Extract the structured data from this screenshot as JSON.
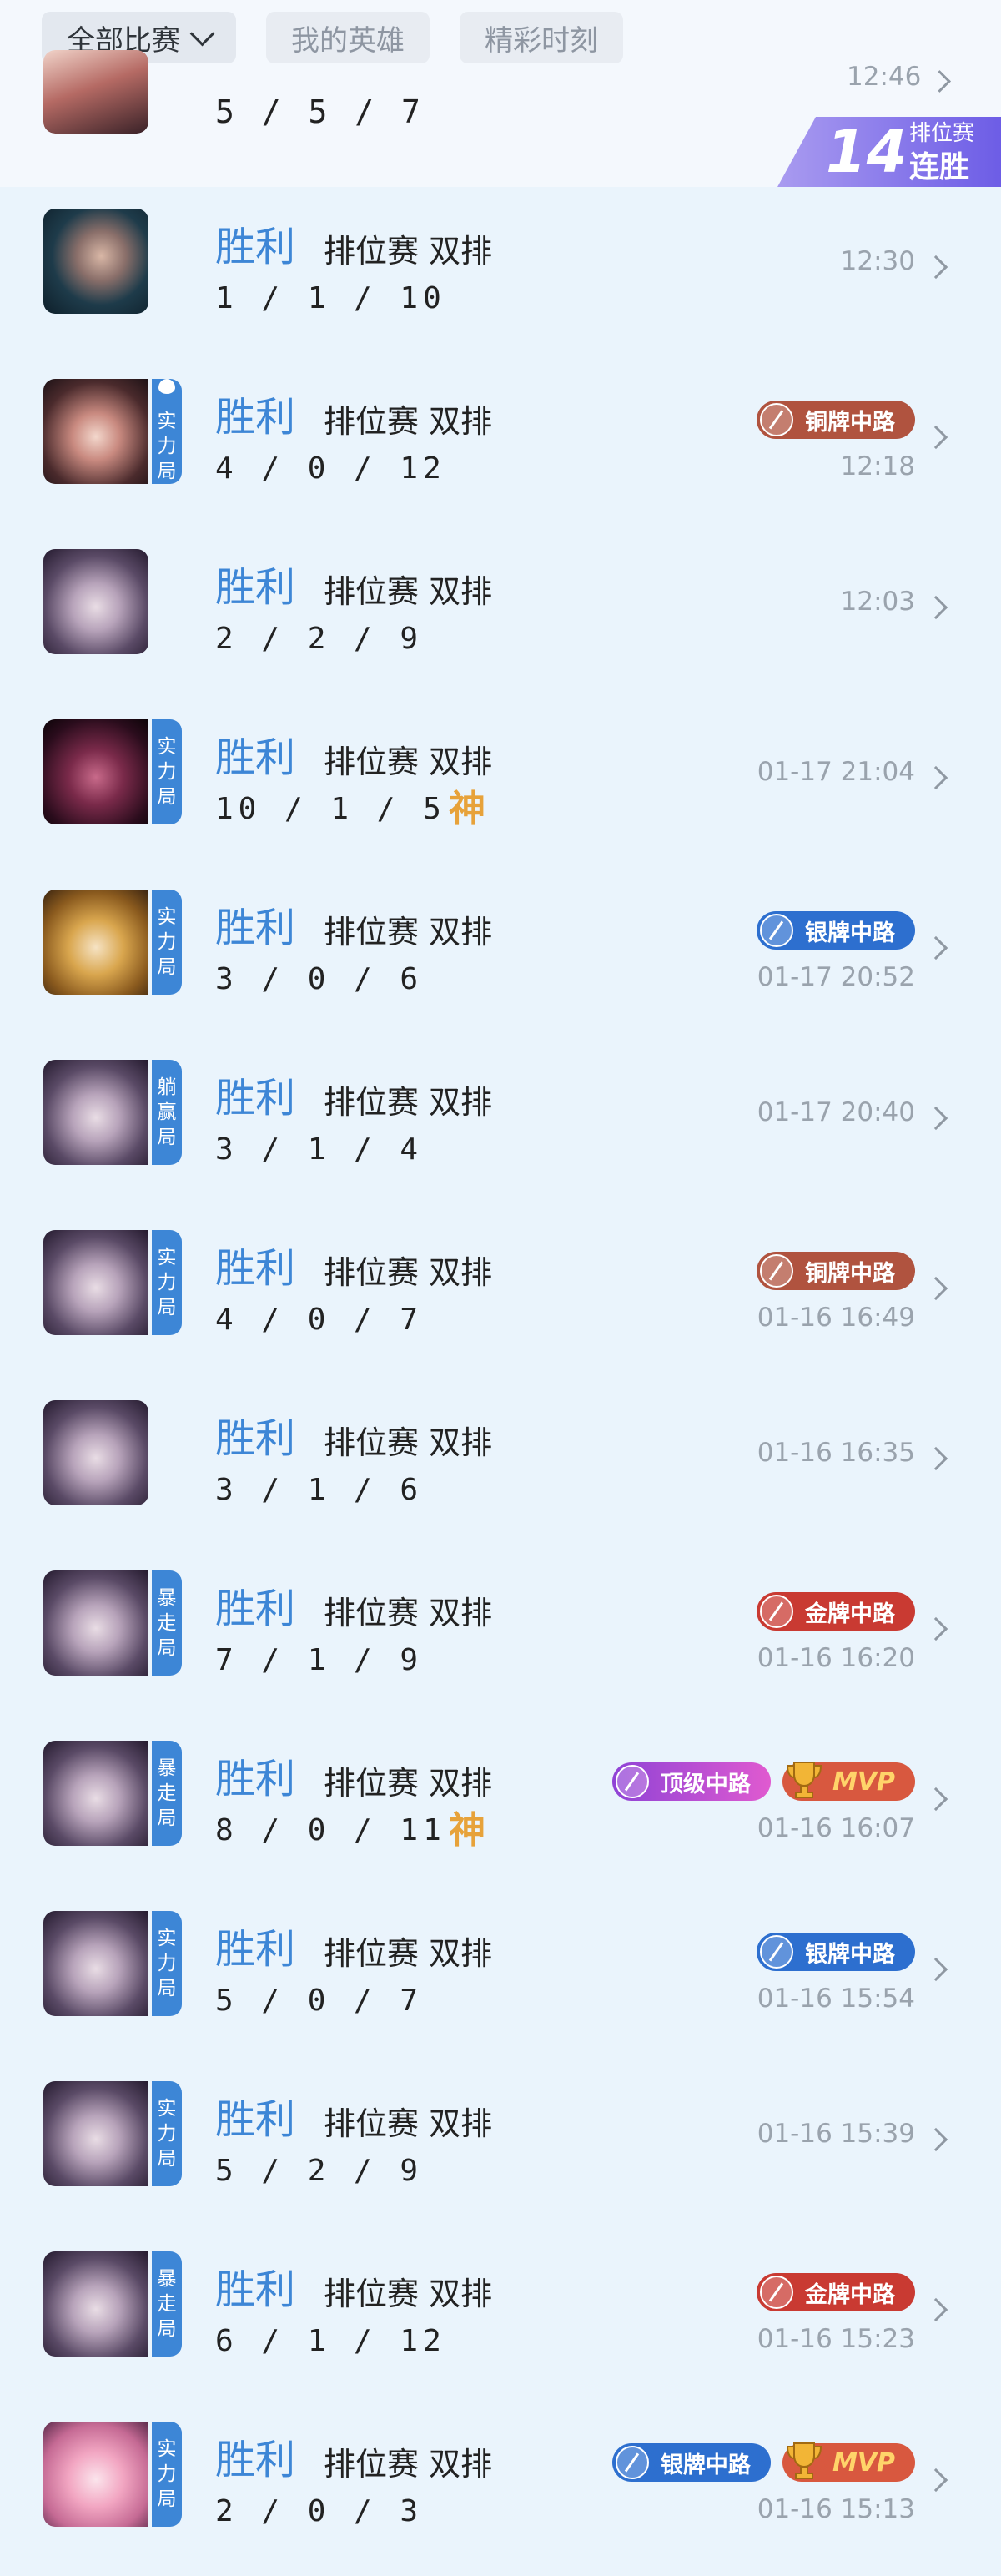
{
  "tabs": [
    {
      "label": "全部比赛",
      "active": true
    },
    {
      "label": "我的英雄",
      "active": false
    },
    {
      "label": "精彩时刻",
      "active": false
    }
  ],
  "previous": {
    "kda": "5 / 5 / 7",
    "time": "12:46"
  },
  "streak": {
    "number": "14",
    "label_top": "排位赛",
    "label_bottom": "连胜"
  },
  "colors": {
    "accent": "#3d86d6",
    "copper": "#b0533f",
    "silver": "#2d6fcf",
    "gold": "#c93a32",
    "top": "#a54bd4"
  },
  "matches": [
    {
      "result": "胜利",
      "mode": "排位赛 双排",
      "kda": "1 / 1 / 10",
      "time": "12:30",
      "tag": "",
      "flame": false,
      "god": "",
      "avatar": "dark-hair-hero",
      "badges": []
    },
    {
      "result": "胜利",
      "mode": "排位赛 双排",
      "kda": "4 / 0 / 12",
      "time": "12:18",
      "tag": "实力局",
      "flame": true,
      "god": "",
      "avatar": "red-hair-hero",
      "badges": [
        {
          "type": "copper",
          "label": "铜牌中路"
        }
      ]
    },
    {
      "result": "胜利",
      "mode": "排位赛 双排",
      "kda": "2 / 2 / 9",
      "time": "12:03",
      "tag": "",
      "flame": false,
      "god": "",
      "avatar": "white-hair-hero",
      "badges": []
    },
    {
      "result": "胜利",
      "mode": "排位赛 双排",
      "kda": "10 / 1 / 5",
      "time": "01-17 21:04",
      "tag": "实力局",
      "flame": false,
      "god": "神",
      "avatar": "demon-hero",
      "badges": []
    },
    {
      "result": "胜利",
      "mode": "排位赛 双排",
      "kda": "3 / 0 / 6",
      "time": "01-17 20:52",
      "tag": "实力局",
      "flame": false,
      "god": "",
      "avatar": "gold-armor-hero",
      "badges": [
        {
          "type": "silver",
          "label": "银牌中路"
        }
      ]
    },
    {
      "result": "胜利",
      "mode": "排位赛 双排",
      "kda": "3 / 1 / 4",
      "time": "01-17 20:40",
      "tag": "躺赢局",
      "flame": false,
      "god": "",
      "avatar": "white-hair-hero",
      "badges": []
    },
    {
      "result": "胜利",
      "mode": "排位赛 双排",
      "kda": "4 / 0 / 7",
      "time": "01-16 16:49",
      "tag": "实力局",
      "flame": false,
      "god": "",
      "avatar": "white-hair-hero",
      "badges": [
        {
          "type": "copper",
          "label": "铜牌中路"
        }
      ]
    },
    {
      "result": "胜利",
      "mode": "排位赛 双排",
      "kda": "3 / 1 / 6",
      "time": "01-16 16:35",
      "tag": "",
      "flame": false,
      "god": "",
      "avatar": "white-hair-hero",
      "badges": []
    },
    {
      "result": "胜利",
      "mode": "排位赛 双排",
      "kda": "7 / 1 / 9",
      "time": "01-16 16:20",
      "tag": "暴走局",
      "flame": false,
      "god": "",
      "avatar": "white-hair-hero",
      "badges": [
        {
          "type": "gold",
          "label": "金牌中路"
        }
      ]
    },
    {
      "result": "胜利",
      "mode": "排位赛 双排",
      "kda": "8 / 0 / 11",
      "time": "01-16 16:07",
      "tag": "暴走局",
      "flame": false,
      "god": "神",
      "avatar": "white-hair-hero",
      "badges": [
        {
          "type": "top",
          "label": "顶级中路"
        },
        {
          "type": "mvp",
          "label": "MVP"
        }
      ]
    },
    {
      "result": "胜利",
      "mode": "排位赛 双排",
      "kda": "5 / 0 / 7",
      "time": "01-16 15:54",
      "tag": "实力局",
      "flame": false,
      "god": "",
      "avatar": "white-hair-hero",
      "badges": [
        {
          "type": "silver",
          "label": "银牌中路"
        }
      ]
    },
    {
      "result": "胜利",
      "mode": "排位赛 双排",
      "kda": "5 / 2 / 9",
      "time": "01-16 15:39",
      "tag": "实力局",
      "flame": false,
      "god": "",
      "avatar": "white-hair-hero",
      "badges": []
    },
    {
      "result": "胜利",
      "mode": "排位赛 双排",
      "kda": "6 / 1 / 12",
      "time": "01-16 15:23",
      "tag": "暴走局",
      "flame": false,
      "god": "",
      "avatar": "white-hair-hero",
      "badges": [
        {
          "type": "gold",
          "label": "金牌中路"
        }
      ]
    },
    {
      "result": "胜利",
      "mode": "排位赛 双排",
      "kda": "2 / 0 / 3",
      "time": "01-16 15:13",
      "tag": "实力局",
      "flame": false,
      "god": "",
      "avatar": "pink-hair-hero",
      "badges": [
        {
          "type": "silver",
          "label": "银牌中路"
        },
        {
          "type": "mvp",
          "label": "MVP"
        }
      ]
    }
  ]
}
